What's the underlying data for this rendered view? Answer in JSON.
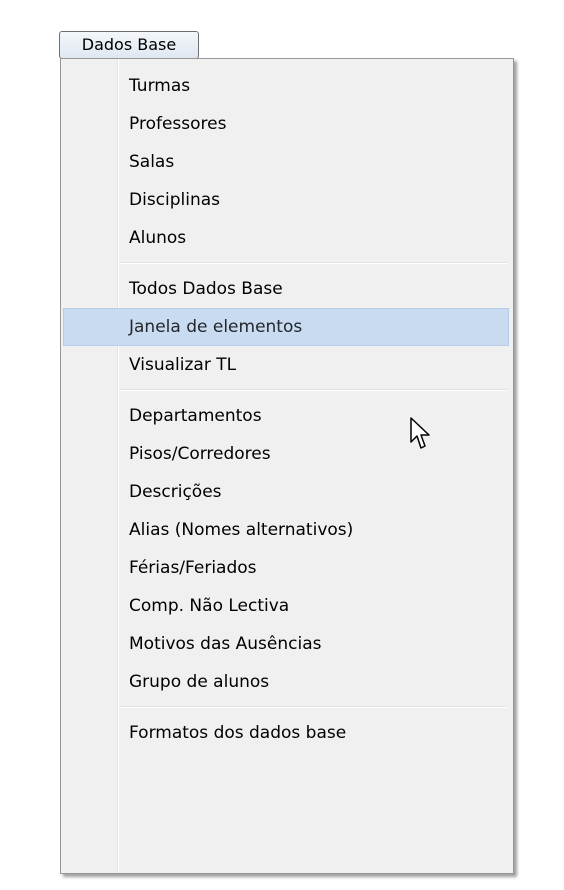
{
  "menu": {
    "button_label": "Dados Base",
    "hovered_item": "Janela de elementos",
    "groups": [
      [
        "Turmas",
        "Professores",
        "Salas",
        "Disciplinas",
        "Alunos"
      ],
      [
        "Todos Dados Base",
        "Janela de elementos",
        "Visualizar TL"
      ],
      [
        "Departamentos",
        "Pisos/Corredores",
        "Descrições",
        "Alias (Nomes alternativos)",
        "Férias/Feriados",
        "Comp. Não Lectiva",
        "Motivos das Ausências",
        "Grupo de alunos"
      ],
      [
        "Formatos dos dados base"
      ]
    ]
  },
  "icons": {
    "cursor": "mouse-pointer-icon"
  },
  "colors": {
    "menu_background": "#f0f0f0",
    "hover_background": "#c8dbf1",
    "hover_border": "#b7cce6",
    "separator": "#e2e3e3"
  }
}
